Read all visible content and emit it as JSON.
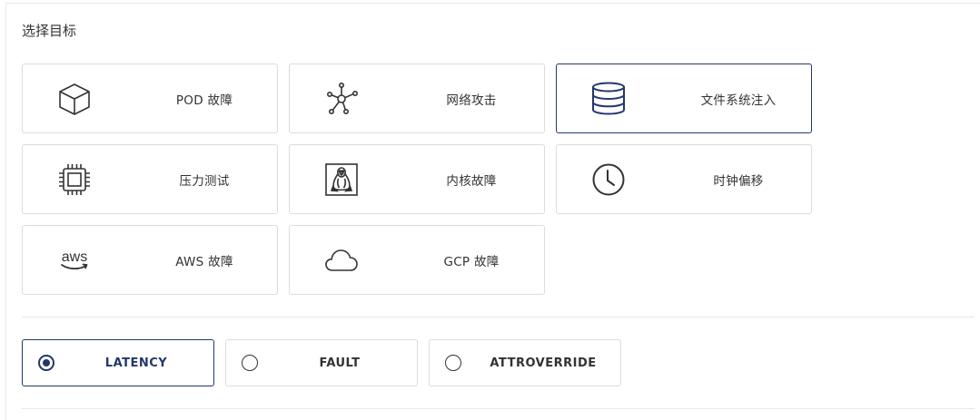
{
  "section": {
    "title": "选择目标"
  },
  "targets": [
    {
      "label": "POD 故障",
      "icon": "cube-icon",
      "selected": false
    },
    {
      "label": "网络攻击",
      "icon": "network-icon",
      "selected": false
    },
    {
      "label": "文件系统注入",
      "icon": "database-icon",
      "selected": true
    },
    {
      "label": "压力测试",
      "icon": "cpu-chip-icon",
      "selected": false
    },
    {
      "label": "内核故障",
      "icon": "linux-penguin-icon",
      "selected": false
    },
    {
      "label": "时钟偏移",
      "icon": "clock-icon",
      "selected": false
    },
    {
      "label": "AWS 故障",
      "icon": "aws-logo-icon",
      "selected": false
    },
    {
      "label": "GCP 故障",
      "icon": "cloud-icon",
      "selected": false
    }
  ],
  "modes": [
    {
      "label": "LATENCY",
      "selected": true
    },
    {
      "label": "FAULT",
      "selected": false
    },
    {
      "label": "ATTROVERRIDE",
      "selected": false
    }
  ],
  "colors": {
    "accent": "#23376b",
    "border": "#dcdcdc",
    "text": "#333333"
  }
}
